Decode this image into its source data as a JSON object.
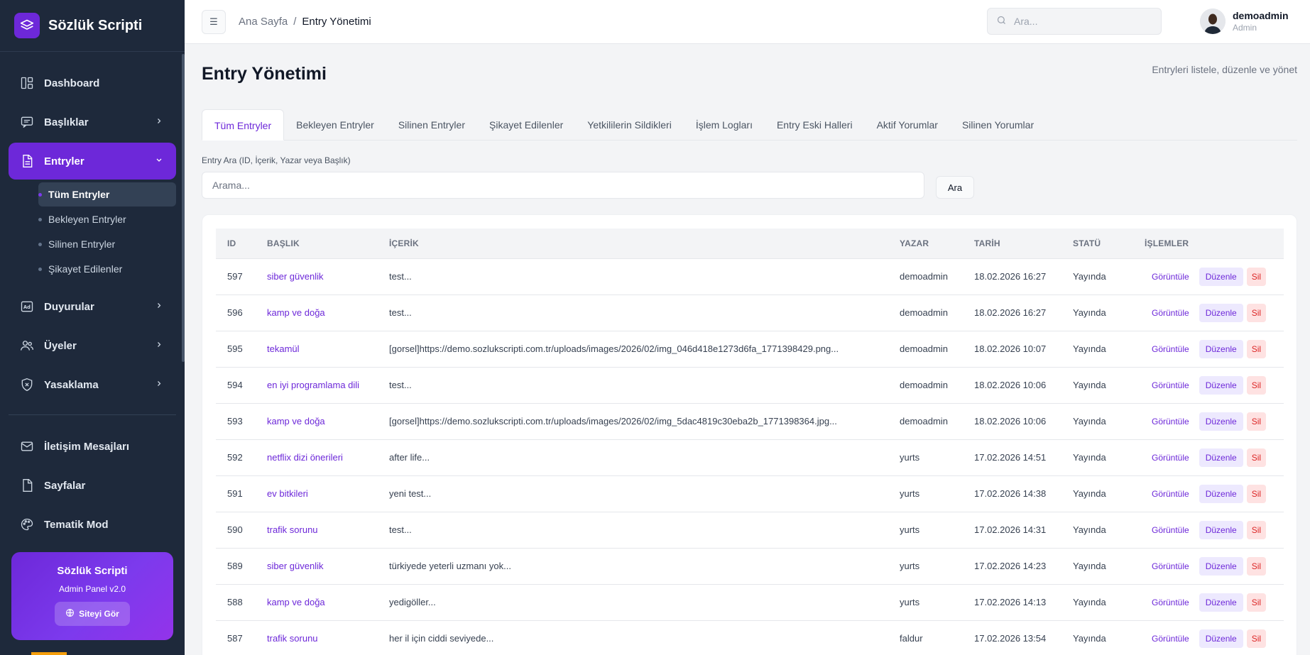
{
  "brand": {
    "name": "Sözlük Scripti"
  },
  "sidebar": {
    "items": [
      {
        "label": "Dashboard",
        "icon": "dashboard-icon"
      },
      {
        "label": "Başlıklar",
        "icon": "message-icon"
      },
      {
        "label": "Entryler",
        "icon": "document-icon"
      },
      {
        "label": "Duyurular",
        "icon": "ad-icon"
      },
      {
        "label": "Üyeler",
        "icon": "users-icon"
      },
      {
        "label": "Yasaklama",
        "icon": "shield-icon"
      },
      {
        "label": "İletişim Mesajları",
        "icon": "mail-icon"
      },
      {
        "label": "Sayfalar",
        "icon": "page-icon"
      },
      {
        "label": "Tematik Mod",
        "icon": "palette-icon"
      }
    ],
    "sub_items": [
      "Tüm Entryler",
      "Bekleyen Entryler",
      "Silinen Entryler",
      "Şikayet Edilenler"
    ],
    "promo": {
      "title": "Sözlük Scripti",
      "subtitle": "Admin Panel v2.0",
      "button": "Siteyi Gör"
    }
  },
  "topbar": {
    "breadcrumb": [
      "Ana Sayfa",
      "Entry Yönetimi"
    ],
    "breadcrumb_sep": "/",
    "search_placeholder": "Ara...",
    "user": {
      "name": "demoadmin",
      "role": "Admin"
    }
  },
  "main": {
    "title": "Entry Yönetimi",
    "subtitle": "Entryleri listele, düzenle ve yönet",
    "tabs": [
      "Tüm Entryler",
      "Bekleyen Entryler",
      "Silinen Entryler",
      "Şikayet Edilenler",
      "Yetkililerin Sildikleri",
      "İşlem Logları",
      "Entry Eski Halleri",
      "Aktif Yorumlar",
      "Silinen Yorumlar"
    ],
    "search_label": "Entry Ara (ID, İçerik, Yazar veya Başlık)",
    "search_placeholder": "Arama...",
    "search_button": "Ara",
    "columns": [
      "ID",
      "BAŞLIK",
      "İÇERİK",
      "YAZAR",
      "TARİH",
      "STATÜ",
      "İŞLEMLER"
    ],
    "actions": {
      "view": "Görüntüle",
      "edit": "Düzenle",
      "delete": "Sil"
    },
    "rows": [
      {
        "id": "597",
        "title": "siber güvenlik",
        "content": "test...",
        "author": "demoadmin",
        "date": "18.02.2026 16:27",
        "status": "Yayında"
      },
      {
        "id": "596",
        "title": "kamp ve doğa",
        "content": "test...",
        "author": "demoadmin",
        "date": "18.02.2026 16:27",
        "status": "Yayında"
      },
      {
        "id": "595",
        "title": "tekamül",
        "content": "[gorsel]https://demo.sozlukscripti.com.tr/uploads/images/2026/02/img_046d418e1273d6fa_1771398429.png...",
        "author": "demoadmin",
        "date": "18.02.2026 10:07",
        "status": "Yayında"
      },
      {
        "id": "594",
        "title": "en iyi programlama dili",
        "content": "test...",
        "author": "demoadmin",
        "date": "18.02.2026 10:06",
        "status": "Yayında"
      },
      {
        "id": "593",
        "title": "kamp ve doğa",
        "content": "[gorsel]https://demo.sozlukscripti.com.tr/uploads/images/2026/02/img_5dac4819c30eba2b_1771398364.jpg...",
        "author": "demoadmin",
        "date": "18.02.2026 10:06",
        "status": "Yayında"
      },
      {
        "id": "592",
        "title": "netflix dizi önerileri",
        "content": "after life...",
        "author": "yurts",
        "date": "17.02.2026 14:51",
        "status": "Yayında"
      },
      {
        "id": "591",
        "title": "ev bitkileri",
        "content": "yeni test...",
        "author": "yurts",
        "date": "17.02.2026 14:38",
        "status": "Yayında"
      },
      {
        "id": "590",
        "title": "trafik sorunu",
        "content": "test...",
        "author": "yurts",
        "date": "17.02.2026 14:31",
        "status": "Yayında"
      },
      {
        "id": "589",
        "title": "siber güvenlik",
        "content": "türkiyede yeterli uzmanı yok...",
        "author": "yurts",
        "date": "17.02.2026 14:23",
        "status": "Yayında"
      },
      {
        "id": "588",
        "title": "kamp ve doğa",
        "content": "yedigöller...",
        "author": "yurts",
        "date": "17.02.2026 14:13",
        "status": "Yayında"
      },
      {
        "id": "587",
        "title": "trafik sorunu",
        "content": "her il için ciddi seviyede...",
        "author": "faldur",
        "date": "17.02.2026 13:54",
        "status": "Yayında"
      }
    ]
  },
  "colors": {
    "accent": "#6d28d9",
    "sidebar_bg": "#1e293b",
    "danger": "#dc2626"
  }
}
